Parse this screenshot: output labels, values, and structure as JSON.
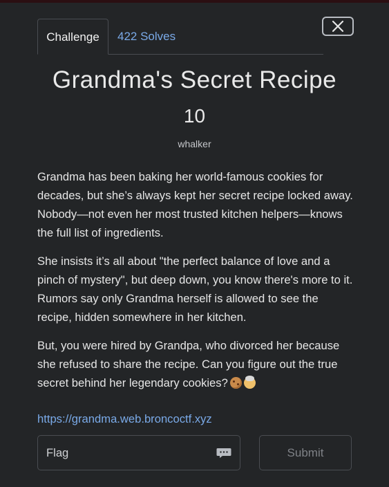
{
  "tabs": {
    "challenge_label": "Challenge",
    "solves_label": "422 Solves"
  },
  "challenge": {
    "title": "Grandma's Secret Recipe",
    "points": "10",
    "author": "whalker",
    "description": [
      "Grandma has been baking her world-famous cookies for decades, but she’s always kept her secret recipe locked away. Nobody—not even her most trusted kitchen helpers—knows the full list of ingredients.",
      "She insists it’s all about \"the perfect balance of love and a pinch of mystery\", but deep down, you know there's more to it. Rumors say only Grandma herself is allowed to see the recipe, hidden somewhere in her kitchen.",
      "But, you were hired by Grandpa, who divorced her because she refused to share the recipe. Can you figure out the true secret behind her legendary cookies?"
    ],
    "emojis": [
      "cookie-icon",
      "grandma-icon"
    ],
    "link": "https://grandma.web.broncoctf.xyz"
  },
  "form": {
    "flag_placeholder": "Flag",
    "flag_value": "",
    "submit_label": "Submit"
  },
  "colors": {
    "background": "#232527",
    "link": "#7aaae8",
    "text": "#e6e6e6",
    "border": "#4a4d52"
  }
}
